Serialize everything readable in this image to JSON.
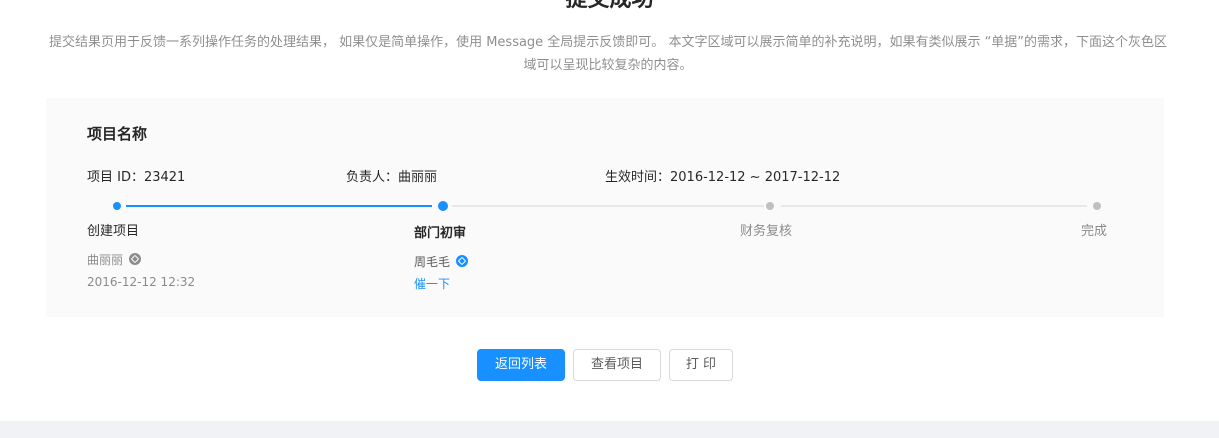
{
  "result": {
    "title": "提交成功",
    "description": "提交结果页用于反馈一系列操作任务的处理结果， 如果仅是简单操作，使用 Message 全局提示反馈即可。 本文字区域可以展示简单的补充说明，如果有类似展示 “单据”的需求，下面这个灰色区域可以呈现比较复杂的内容。"
  },
  "project": {
    "name": "项目名称",
    "id_text": "项目 ID：23421",
    "owner_text": "负责人：曲丽丽",
    "effective_text": "生效时间：2016-12-12 ~ 2017-12-12"
  },
  "steps": [
    {
      "title": "创建项目",
      "status": "finish",
      "person": "曲丽丽",
      "time": "2016-12-12 12:32"
    },
    {
      "title": "部门初审",
      "status": "process",
      "person": "周毛毛",
      "action": "催一下"
    },
    {
      "title": "财务复核",
      "status": "wait"
    },
    {
      "title": "完成",
      "status": "wait"
    }
  ],
  "actions": {
    "back_label": "返回列表",
    "view_label": "查看项目",
    "print_label": "打 印"
  },
  "colors": {
    "primary": "#1890ff",
    "panel_bg": "#fafafa",
    "wait_gray": "#bfbfbf",
    "footer_bg": "#f0f2f5"
  },
  "icons": {
    "person_badge_finish": "dingding-icon",
    "person_badge_process": "dingding-icon"
  }
}
